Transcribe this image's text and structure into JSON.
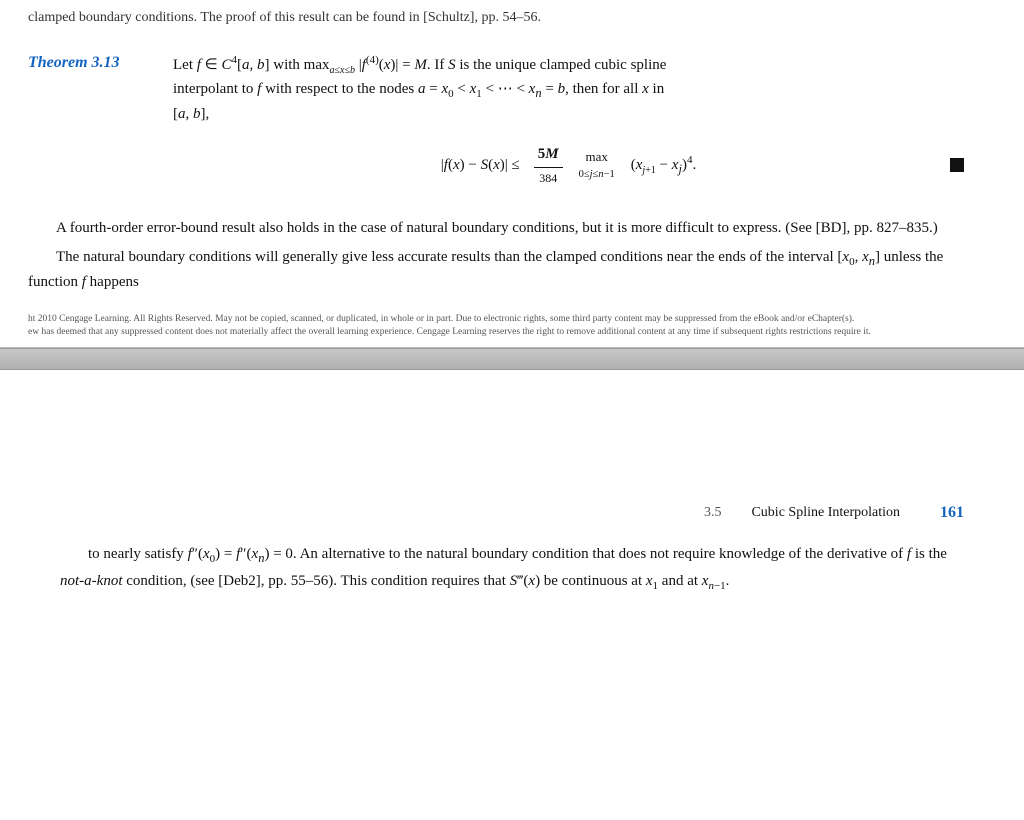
{
  "page": {
    "top_partial": "clamped boundary conditions. The proof of this result can be found in [Schultz], pp. 54–56.",
    "theorem_label": "Theorem 3.13",
    "theorem_text_line1": "Let f ∈ C⁴[a, b] with max_{a≤x≤b} |f⁽⁴⁾(x)| = M. If S is the unique clamped cubic spline",
    "theorem_text_line2": "interpolant to f with respect to the nodes a = x₀ < x₁ < ⋯ < xₙ = b, then for all x in",
    "theorem_text_line3": "[a, b],",
    "formula_left": "|f(x) − S(x)| ≤",
    "formula_fraction_num": "5M",
    "formula_fraction_den": "384",
    "formula_max_label": "max",
    "formula_subscript": "0≤j≤n−1",
    "formula_right": "(x_{j+1} − x_j)⁴.",
    "para1": "A fourth-order error-bound result also holds in the case of natural boundary conditions, but it is more difficult to express. (See [BD], pp. 827–835.)",
    "para2": "The natural boundary conditions will generally give less accurate results than the clamped conditions near the ends of the interval [x₀, xₙ] unless the function f happens",
    "copyright_line1": "ht 2010 Cengage Learning. All Rights Reserved. May not be copied, scanned, or duplicated, in whole or in part. Due to electronic rights, some third party content may be suppressed from the eBook and/or eChapter(s).",
    "copyright_line2": "ew has deemed that any suppressed content does not materially affect the overall learning experience. Cengage Learning reserves the right to remove additional content at any time if subsequent rights restrictions require it.",
    "footer_section_num": "3.5",
    "footer_section_title": "Cubic Spline Interpolation",
    "footer_page_num": "161",
    "bottom_para": "to nearly satisfy f ″(x₀) = f ″(xₙ) = 0. An alternative to the natural boundary condition that does not require knowledge of the derivative of f is the not-a-knot condition, (see [Deb2], pp. 55–56). This condition requires that S‴(x) be continuous at x₁ and at xₙ₋₁."
  }
}
